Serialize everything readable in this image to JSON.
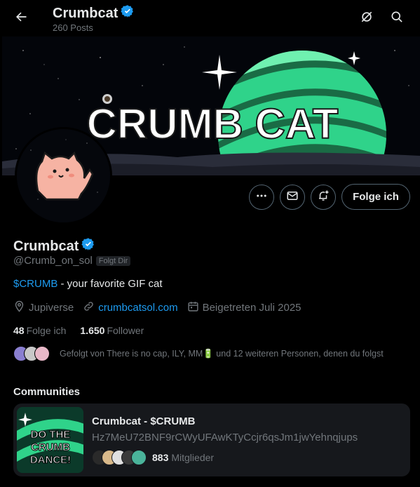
{
  "header": {
    "title": "Crumbcat",
    "posts": "260 Posts",
    "back_icon": "arrow-left-icon",
    "icons": [
      "grok-icon",
      "search-icon"
    ]
  },
  "banner": {
    "headline": "CRUMB CAT"
  },
  "actions": {
    "more_icon": "more-icon",
    "message_icon": "mail-icon",
    "notify_icon": "bell-plus-icon",
    "follow_label": "Folge ich"
  },
  "profile": {
    "name": "Crumbcat",
    "handle": "@Crumb_on_sol",
    "follows_you": "Folgt Dir",
    "bio_cashtag": "$CRUMB",
    "bio_text": " - your favorite GIF cat",
    "location": "Jupiverse",
    "website": "crumbcatsol.com",
    "joined": "Beigetreten Juli 2025",
    "following_count": "48",
    "following_label": "Folge ich",
    "followers_count": "1.650",
    "followers_label": "Follower",
    "followed_by": "Gefolgt von There is no cap, ILY, MM🔋 und 12 weiteren Personen, denen du folgst"
  },
  "communities": {
    "section_title": "Communities",
    "card": {
      "name": "Crumbcat - $CRUMB",
      "description": "Hz7MeU72BNF9rCWyUFAwKTyCcjr6qsJm1jwYehnqjups",
      "member_count": "883",
      "member_label": "Mitglieder",
      "image_text": "DO THE CRUMB DANCE!"
    }
  },
  "colors": {
    "accent": "#1d9bf0",
    "muted": "#71767b",
    "text": "#e7e9ea",
    "card_bg": "#16181c"
  }
}
